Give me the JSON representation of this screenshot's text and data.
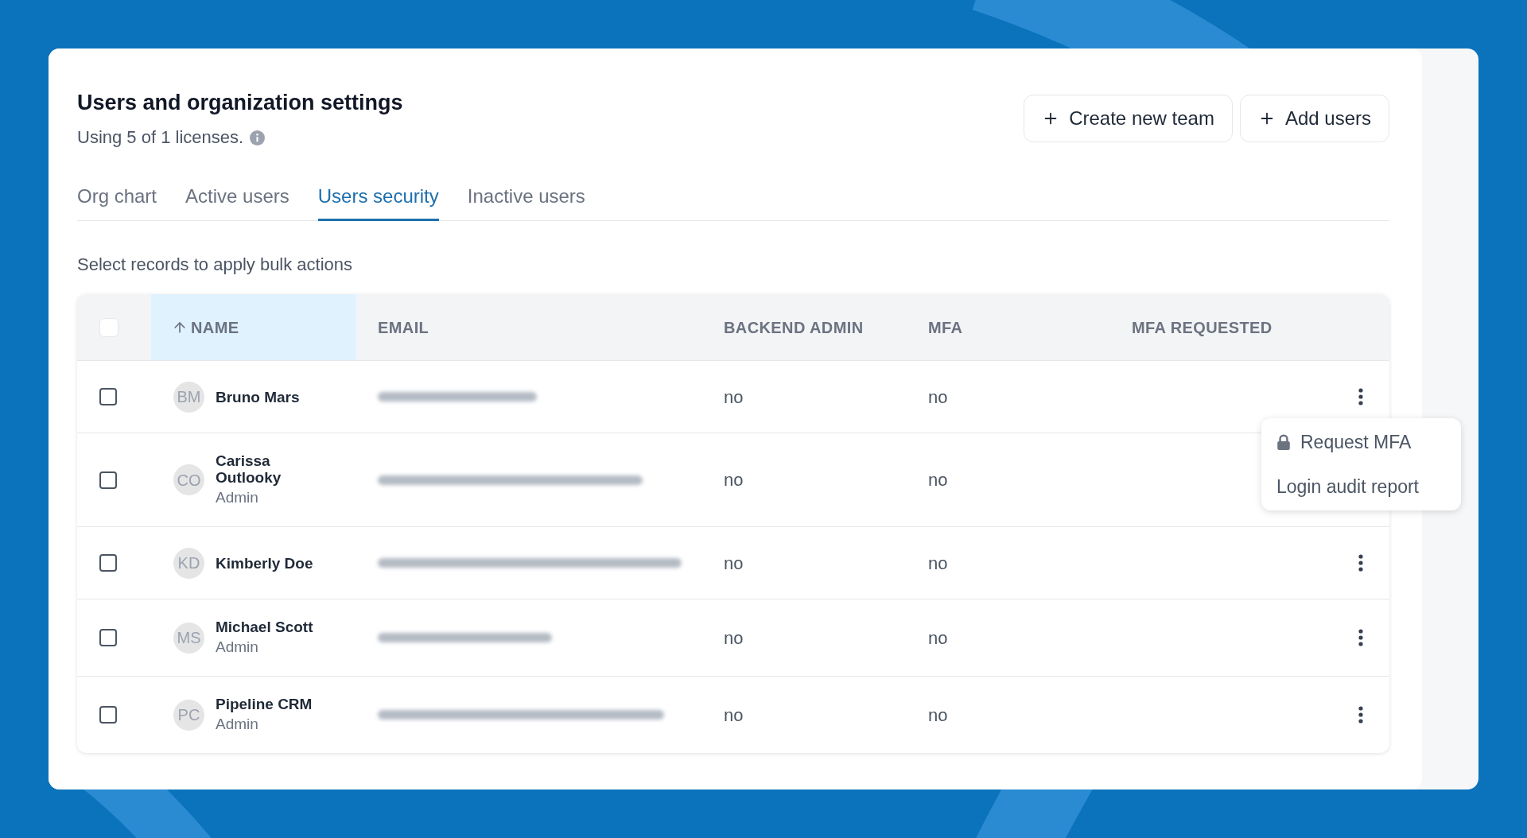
{
  "page": {
    "title": "Users and organization settings",
    "licenses": "Using 5 of 1 licenses."
  },
  "header_buttons": [
    {
      "label": "Create new team"
    },
    {
      "label": "Add users"
    }
  ],
  "tabs": [
    {
      "label": "Org chart",
      "selected": false
    },
    {
      "label": "Active users",
      "selected": false
    },
    {
      "label": "Users security",
      "selected": true
    },
    {
      "label": "Inactive users",
      "selected": false
    }
  ],
  "bulk_hint": "Select records to apply bulk actions",
  "table": {
    "select_all": {
      "checked": false
    },
    "columns": [
      {
        "label": "NAME",
        "sorted": true
      },
      {
        "label": "EMAIL",
        "sorted": false
      },
      {
        "label": "BACKEND ADMIN",
        "sorted": false
      },
      {
        "label": "MFA",
        "sorted": false
      },
      {
        "label": "MFA REQUESTED",
        "sorted": false
      }
    ],
    "rows": [
      {
        "checked": false,
        "initials": "BM",
        "name": "Bruno Mars",
        "backend_admin": "no",
        "mfa": "no"
      },
      {
        "checked": false,
        "initials": "CO",
        "name": "Carissa Outlooky",
        "role": "Admin",
        "backend_admin": "no",
        "mfa": "no"
      },
      {
        "checked": false,
        "initials": "KD",
        "name": "Kimberly Doe",
        "backend_admin": "no",
        "mfa": "no"
      },
      {
        "checked": false,
        "initials": "MS",
        "name": "Michael Scott",
        "role": "Admin",
        "backend_admin": "no",
        "mfa": "no"
      },
      {
        "checked": false,
        "initials": "PC",
        "name": "Pipeline CRM",
        "role": "Admin",
        "backend_admin": "no",
        "mfa": "no"
      }
    ]
  },
  "row_menu": {
    "open": true,
    "items": [
      {
        "label": "Request MFA",
        "kind": "locked"
      },
      {
        "label": "Login audit report",
        "kind": "plain"
      }
    ]
  }
}
